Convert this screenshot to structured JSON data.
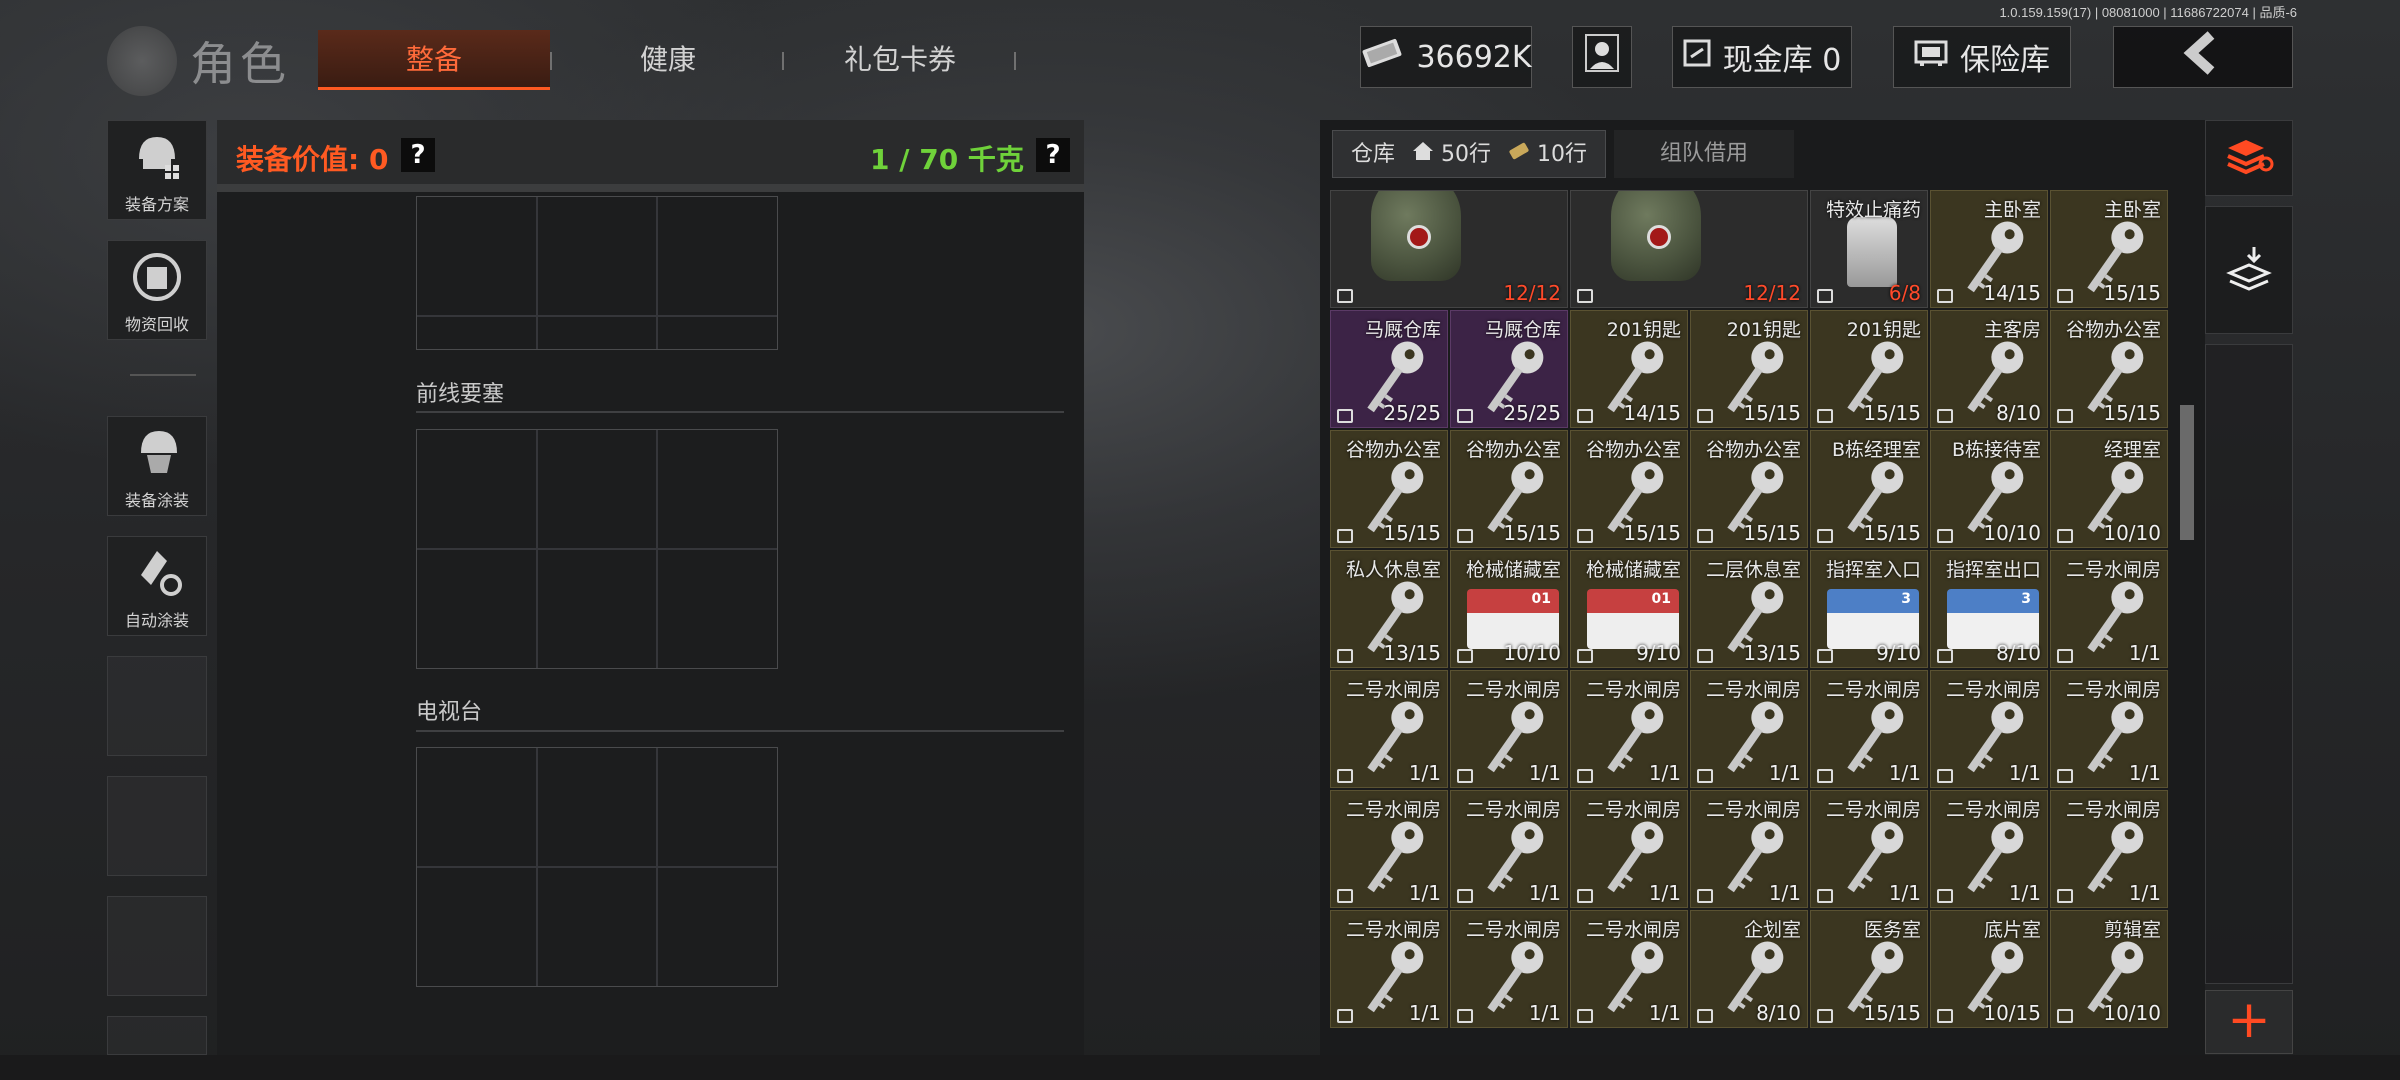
{
  "version_text": "1.0.159.159(17) | 08081000 | 11686722074 | 品质-6",
  "header": {
    "title": "角色",
    "tabs": [
      {
        "label": "整备",
        "active": true
      },
      {
        "label": "健康",
        "active": false
      },
      {
        "label": "礼包卡券",
        "active": false
      }
    ],
    "currency": "36692K",
    "cash_vault": "现金库 0",
    "safe_vault": "保险库"
  },
  "sidebar": {
    "items": [
      {
        "label": "装备方案",
        "icon": "loadout-icon"
      },
      {
        "label": "物资回收",
        "icon": "recycle-icon"
      },
      {
        "label": "装备涂装",
        "icon": "skin-icon"
      },
      {
        "label": "自动涂装",
        "icon": "auto-paint-icon"
      }
    ]
  },
  "equipment": {
    "value_label": "装备价值: 0",
    "weight_label": "1 / 70 千克",
    "help": "?",
    "sections": [
      "前线要塞",
      "电视台"
    ]
  },
  "warehouse": {
    "tab_label": "仓库",
    "rows_home": "50行",
    "rows_ticket": "10行",
    "team_borrow": "组队借用",
    "colors": {
      "gold_cell": "#3b3620",
      "purple_cell": "#3c2346",
      "dark_cell": "#2c2c2c",
      "qty_red": "#ff4a2a"
    },
    "rows": [
      [
        {
          "name": "",
          "qty": "12/12",
          "kind": "helmet",
          "style": "dark",
          "red": true
        },
        {
          "name": "",
          "qty": "12/12",
          "kind": "helmet",
          "style": "dark",
          "red": true
        },
        {
          "name": "特效止痛药",
          "qty": "6/8",
          "kind": "bottle",
          "style": "dark",
          "red": true
        },
        {
          "name": "主卧室",
          "qty": "14/15",
          "kind": "key",
          "style": "gold"
        },
        {
          "name": "主卧室",
          "qty": "15/15",
          "kind": "key",
          "style": "gold"
        }
      ],
      [
        {
          "name": "马厩仓库",
          "qty": "25/25",
          "kind": "key",
          "style": "purple"
        },
        {
          "name": "马厩仓库",
          "qty": "25/25",
          "kind": "key",
          "style": "purple"
        },
        {
          "name": "201钥匙",
          "qty": "14/15",
          "kind": "key",
          "style": "gold"
        },
        {
          "name": "201钥匙",
          "qty": "15/15",
          "kind": "key",
          "style": "gold"
        },
        {
          "name": "201钥匙",
          "qty": "15/15",
          "kind": "key",
          "style": "gold"
        },
        {
          "name": "主客房",
          "qty": "8/10",
          "kind": "key",
          "style": "gold"
        },
        {
          "name": "谷物办公室",
          "qty": "15/15",
          "kind": "key",
          "style": "gold"
        }
      ],
      [
        {
          "name": "谷物办公室",
          "qty": "15/15",
          "kind": "key",
          "style": "gold"
        },
        {
          "name": "谷物办公室",
          "qty": "15/15",
          "kind": "key",
          "style": "gold"
        },
        {
          "name": "谷物办公室",
          "qty": "15/15",
          "kind": "key",
          "style": "gold"
        },
        {
          "name": "谷物办公室",
          "qty": "15/15",
          "kind": "key",
          "style": "gold"
        },
        {
          "name": "B栋经理室",
          "qty": "15/15",
          "kind": "key",
          "style": "gold"
        },
        {
          "name": "B栋接待室",
          "qty": "10/10",
          "kind": "key",
          "style": "gold"
        },
        {
          "name": "经理室",
          "qty": "10/10",
          "kind": "key",
          "style": "gold"
        }
      ],
      [
        {
          "name": "私人休息室",
          "qty": "13/15",
          "kind": "key",
          "style": "gold"
        },
        {
          "name": "枪械储藏室",
          "qty": "10/10",
          "kind": "card",
          "style": "gold",
          "card_num": "01"
        },
        {
          "name": "枪械储藏室",
          "qty": "9/10",
          "kind": "card",
          "style": "gold",
          "card_num": "01"
        },
        {
          "name": "二层休息室",
          "qty": "13/15",
          "kind": "key",
          "style": "gold"
        },
        {
          "name": "指挥室入口",
          "qty": "9/10",
          "kind": "card-blue",
          "style": "gold",
          "card_num": "3"
        },
        {
          "name": "指挥室出口",
          "qty": "8/10",
          "kind": "card-blue",
          "style": "gold",
          "card_num": "3"
        },
        {
          "name": "二号水闸房",
          "qty": "1/1",
          "kind": "key",
          "style": "gold"
        }
      ],
      [
        {
          "name": "二号水闸房",
          "qty": "1/1",
          "kind": "key",
          "style": "gold"
        },
        {
          "name": "二号水闸房",
          "qty": "1/1",
          "kind": "key",
          "style": "gold"
        },
        {
          "name": "二号水闸房",
          "qty": "1/1",
          "kind": "key",
          "style": "gold"
        },
        {
          "name": "二号水闸房",
          "qty": "1/1",
          "kind": "key",
          "style": "gold"
        },
        {
          "name": "二号水闸房",
          "qty": "1/1",
          "kind": "key",
          "style": "gold"
        },
        {
          "name": "二号水闸房",
          "qty": "1/1",
          "kind": "key",
          "style": "gold"
        },
        {
          "name": "二号水闸房",
          "qty": "1/1",
          "kind": "key",
          "style": "gold"
        }
      ],
      [
        {
          "name": "二号水闸房",
          "qty": "1/1",
          "kind": "key",
          "style": "gold"
        },
        {
          "name": "二号水闸房",
          "qty": "1/1",
          "kind": "key",
          "style": "gold"
        },
        {
          "name": "二号水闸房",
          "qty": "1/1",
          "kind": "key",
          "style": "gold"
        },
        {
          "name": "二号水闸房",
          "qty": "1/1",
          "kind": "key",
          "style": "gold"
        },
        {
          "name": "二号水闸房",
          "qty": "1/1",
          "kind": "key",
          "style": "gold"
        },
        {
          "name": "二号水闸房",
          "qty": "1/1",
          "kind": "key",
          "style": "gold"
        },
        {
          "name": "二号水闸房",
          "qty": "1/1",
          "kind": "key",
          "style": "gold"
        }
      ],
      [
        {
          "name": "二号水闸房",
          "qty": "1/1",
          "kind": "key",
          "style": "gold"
        },
        {
          "name": "二号水闸房",
          "qty": "1/1",
          "kind": "key",
          "style": "gold"
        },
        {
          "name": "二号水闸房",
          "qty": "1/1",
          "kind": "key",
          "style": "gold"
        },
        {
          "name": "企划室",
          "qty": "8/10",
          "kind": "key",
          "style": "gold"
        },
        {
          "name": "医务室",
          "qty": "15/15",
          "kind": "key",
          "style": "gold"
        },
        {
          "name": "底片室",
          "qty": "10/15",
          "kind": "key",
          "style": "gold"
        },
        {
          "name": "剪辑室",
          "qty": "10/10",
          "kind": "key",
          "style": "gold"
        }
      ]
    ]
  },
  "right_toolbar": {
    "plus": "+"
  }
}
